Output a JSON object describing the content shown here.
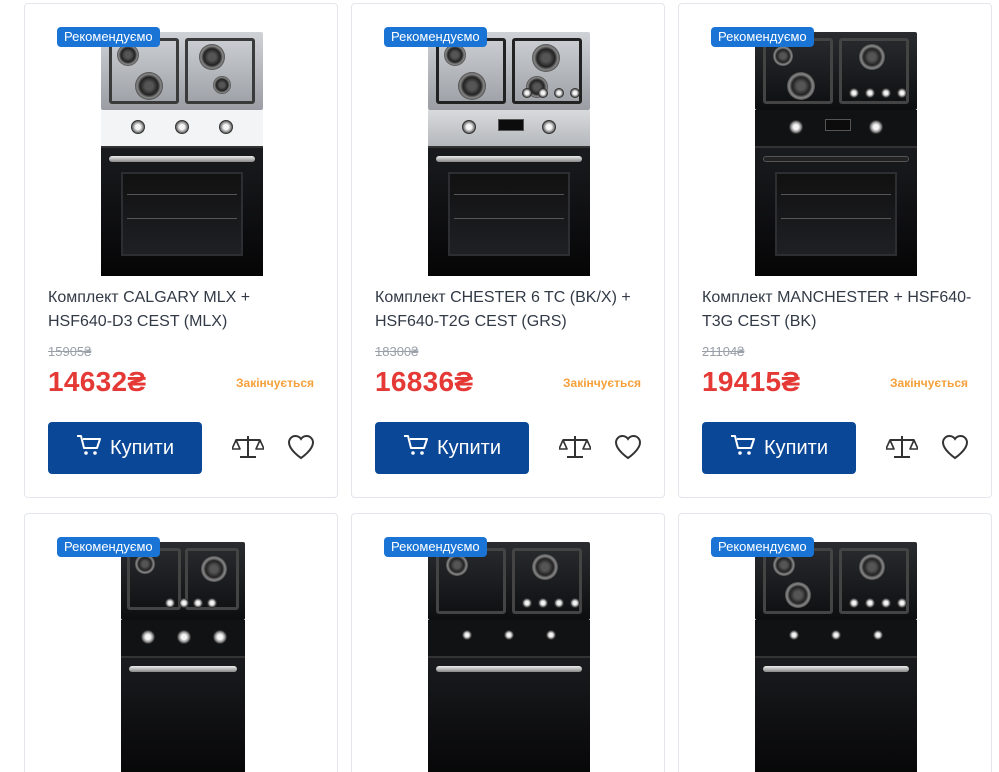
{
  "products": [
    {
      "badge": "Рекомендуємо",
      "name": "Комплект CALGARY MLX + HSF640-D3 CEST (MLX)",
      "old_price": "15905₴",
      "price": "14632₴",
      "status": "Закінчується",
      "buy_label": "Купити",
      "image_variant": "steel-white"
    },
    {
      "badge": "Рекомендуємо",
      "name": "Комплект CHESTER 6 TC (BK/X) + HSF640-T2G CEST (GRS)",
      "old_price": "18300₴",
      "price": "16836₴",
      "status": "Закінчується",
      "buy_label": "Купити",
      "image_variant": "steel"
    },
    {
      "badge": "Рекомендуємо",
      "name": "Комплект MANCHESTER + HSF640-T3G CEST (BK)",
      "old_price": "21104₴",
      "price": "19415₴",
      "status": "Закінчується",
      "buy_label": "Купити",
      "image_variant": "black"
    },
    {
      "badge": "Рекомендуємо",
      "image_variant": "black"
    },
    {
      "badge": "Рекомендуємо",
      "image_variant": "black"
    },
    {
      "badge": "Рекомендуємо",
      "image_variant": "black"
    }
  ],
  "colors": {
    "badge": "#1a74d6",
    "buy_button": "#0a4796",
    "price": "#e53935",
    "status": "#f5a03a",
    "old_price": "#9aa0a8"
  },
  "icons": {
    "cart": "cart-icon",
    "compare": "scales-compare-icon",
    "wishlist": "heart-icon"
  }
}
